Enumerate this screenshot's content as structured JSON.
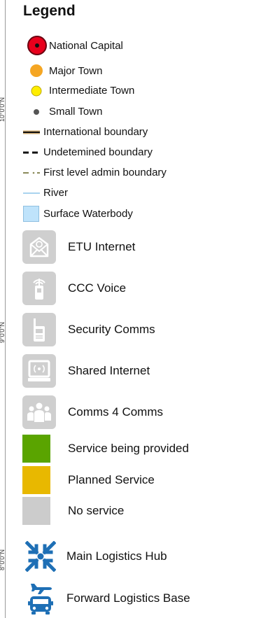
{
  "legend": {
    "title": "Legend",
    "coordinates": [
      "10°0'0\"N",
      "9°0'0\"N",
      "8°0'0\"N"
    ],
    "points": [
      {
        "icon": "national-capital-icon",
        "label": "National Capital"
      },
      {
        "icon": "major-town-icon",
        "label": "Major Town"
      },
      {
        "icon": "intermediate-town-icon",
        "label": "Intermediate Town"
      },
      {
        "icon": "small-town-icon",
        "label": "Small Town"
      }
    ],
    "lines": [
      {
        "icon": "international-boundary-icon",
        "label": "International boundary"
      },
      {
        "icon": "undetermined-boundary-icon",
        "label": "Undetemined boundary"
      },
      {
        "icon": "admin-boundary-icon",
        "label": "First level admin boundary"
      },
      {
        "icon": "river-icon",
        "label": "River"
      },
      {
        "icon": "waterbody-icon",
        "label": "Surface Waterbody"
      }
    ],
    "services": [
      {
        "icon": "email-icon",
        "label": "ETU Internet"
      },
      {
        "icon": "phone-icon",
        "label": "CCC Voice"
      },
      {
        "icon": "radio-icon",
        "label": "Security Comms"
      },
      {
        "icon": "computer-icon",
        "label": "Shared Internet"
      },
      {
        "icon": "people-icon",
        "label": "Comms 4 Comms"
      }
    ],
    "status": [
      {
        "color": "#5aa400",
        "label": "Service being provided"
      },
      {
        "color": "#e8b800",
        "label": "Planned Service"
      },
      {
        "color": "#cccccc",
        "label": "No service"
      }
    ],
    "logistics": [
      {
        "icon": "logistics-hub-icon",
        "label": "Main Logistics Hub"
      },
      {
        "icon": "forward-base-icon",
        "label": "Forward Logistics Base"
      }
    ],
    "colors": {
      "capital": "#e8001c",
      "major_town": "#f5a623",
      "intermediate_town": "#ffee00",
      "small_town": "#555555",
      "river": "#a9d3ef",
      "waterbody_fill": "#bfe3fb",
      "waterbody_border": "#8fbfe0",
      "logistics": "#1e6fb5",
      "tile": "#cfcfcf"
    }
  }
}
